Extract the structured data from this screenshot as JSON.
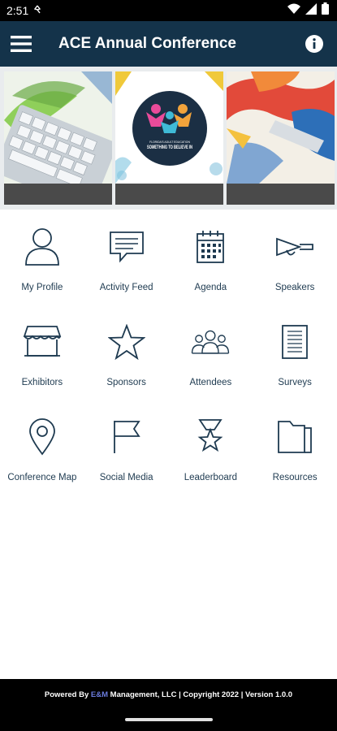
{
  "status_bar": {
    "time": "2:51",
    "icons": [
      "notification-icon",
      "wifi-icon",
      "signal-icon",
      "battery-icon"
    ]
  },
  "app_bar": {
    "title": "ACE Annual Conference",
    "icons": [
      "menu-icon",
      "info-icon"
    ]
  },
  "banner": {
    "logo_caption_small": "FLORIDA'S ADULT EDUCATION",
    "logo_caption_large": "SOMETHING TO BELIEVE IN",
    "slide_captions": [
      "",
      "",
      ""
    ]
  },
  "menu": [
    {
      "label": "My Profile",
      "icon": "user-icon"
    },
    {
      "label": "Activity Feed",
      "icon": "chat-icon"
    },
    {
      "label": "Agenda",
      "icon": "calendar-icon"
    },
    {
      "label": "Speakers",
      "icon": "megaphone-icon"
    },
    {
      "label": "Exhibitors",
      "icon": "storefront-icon"
    },
    {
      "label": "Sponsors",
      "icon": "star-icon"
    },
    {
      "label": "Attendees",
      "icon": "group-icon"
    },
    {
      "label": "Surveys",
      "icon": "document-icon"
    },
    {
      "label": "Conference Map",
      "icon": "map-pin-icon"
    },
    {
      "label": "Social Media",
      "icon": "flag-icon"
    },
    {
      "label": "Leaderboard",
      "icon": "trophy-icon"
    },
    {
      "label": "Resources",
      "icon": "folder-icon"
    }
  ],
  "footer": {
    "prefix": "Powered By ",
    "brand": "E&M",
    "suffix": " Management, LLC | Copyright 2022 | Version 1.0.0"
  },
  "colors": {
    "app_bar": "#14334a",
    "icon_stroke": "#1e3a50",
    "footer_bg": "#000000",
    "brand_accent": "#6a7bdc"
  }
}
